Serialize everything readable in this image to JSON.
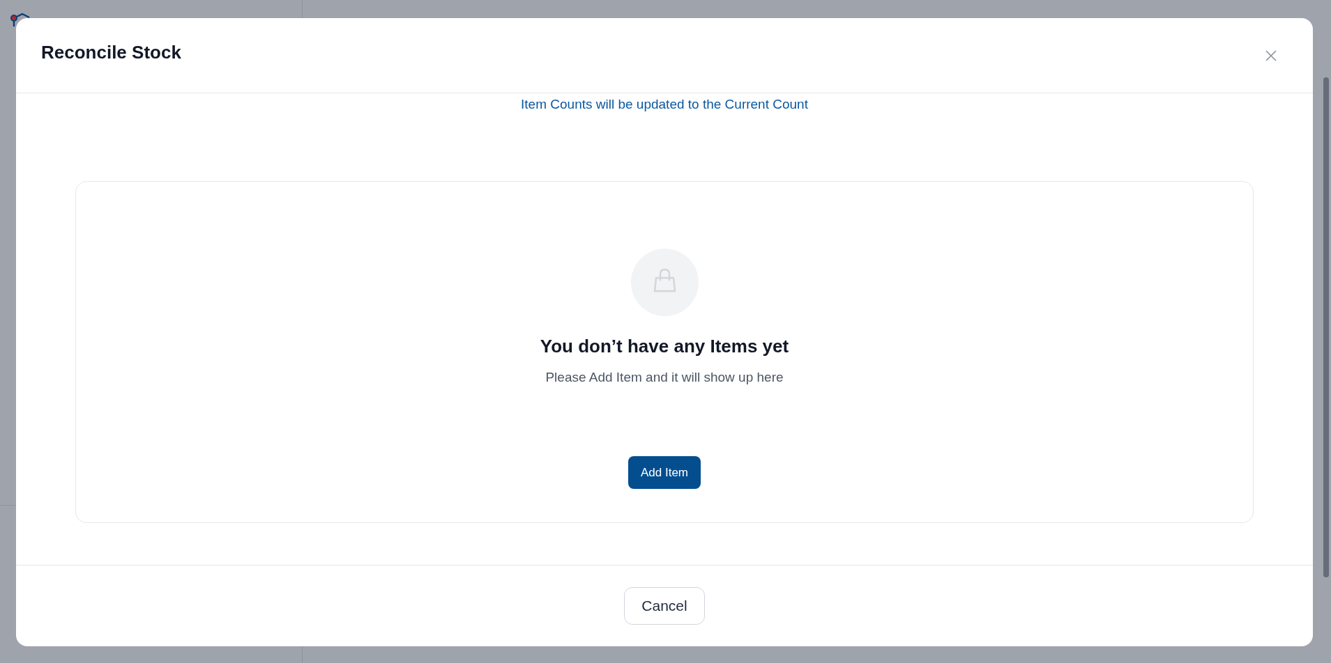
{
  "dialog": {
    "title": "Reconcile Stock"
  },
  "notice": "Item Counts will be updated to the Current Count",
  "empty_state": {
    "title": "You don’t have any Items yet",
    "message": "Please Add Item and it will show up here",
    "action": "Add Item"
  },
  "footer": {
    "buttons": [
      "Cancel"
    ]
  }
}
